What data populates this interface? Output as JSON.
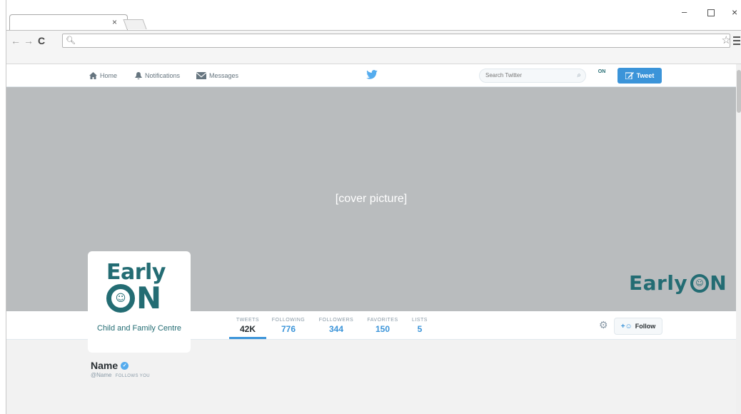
{
  "browser": {
    "tab_close": "×",
    "window_controls": {
      "minimize": "–",
      "close": "×"
    },
    "address_bar_value": "",
    "icons": [
      "back-arrow-icon",
      "forward-arrow-icon",
      "reload-icon",
      "search-icon",
      "star-icon",
      "menu-icon"
    ]
  },
  "twitter_nav": {
    "home": "Home",
    "notifications": "Notifications",
    "messages": "Messages",
    "search_placeholder": "Search Twitter",
    "tweet_button": "Tweet",
    "small_avatar_text": "ON"
  },
  "cover": {
    "label": "[cover picture]",
    "brand_left": "Early",
    "brand_right": "N"
  },
  "profile_logo": {
    "early": "Early",
    "on_suffix": "N",
    "subtitle": "Child and Family Centre"
  },
  "stats": [
    {
      "label": "TWEETS",
      "value": "42K"
    },
    {
      "label": "FOLLOWING",
      "value": "776"
    },
    {
      "label": "FOLLOWERS",
      "value": "344"
    },
    {
      "label": "FAVORITES",
      "value": "150"
    },
    {
      "label": "LISTS",
      "value": "5"
    }
  ],
  "follow_button": "Follow",
  "profile": {
    "name": "Name",
    "handle": "@Name",
    "follows_you": "FOLLOWS YOU"
  },
  "colors": {
    "twitter_blue": "#3b94d9",
    "brand_teal": "#236c73",
    "cover_gray": "#b9bcbe"
  }
}
